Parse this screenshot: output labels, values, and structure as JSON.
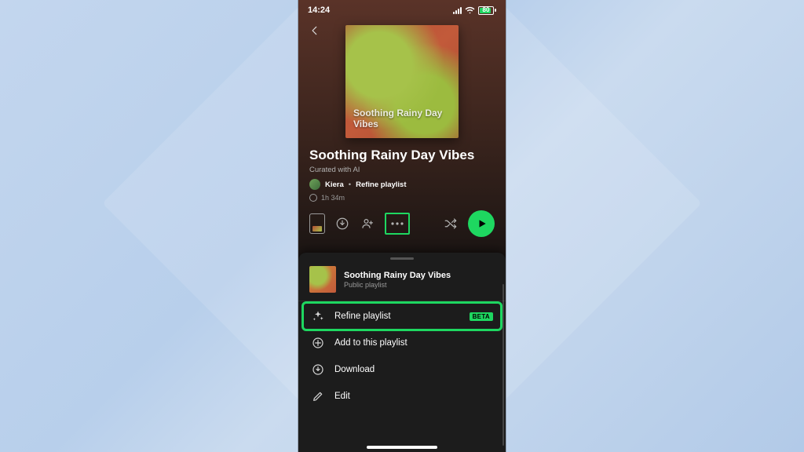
{
  "status": {
    "time": "14:24",
    "battery_label": "80"
  },
  "playlist": {
    "title": "Soothing Rainy Day Vibes",
    "cover_text": "Soothing Rainy Day Vibes",
    "subtitle": "Curated with AI",
    "owner": "Kiera",
    "refine_link": "Refine playlist",
    "duration": "1h 34m"
  },
  "sheet": {
    "title": "Soothing Rainy Day Vibes",
    "subtitle": "Public playlist",
    "beta_label": "BETA",
    "items": [
      {
        "label": "Refine playlist"
      },
      {
        "label": "Add to this playlist"
      },
      {
        "label": "Download"
      },
      {
        "label": "Edit"
      }
    ]
  }
}
